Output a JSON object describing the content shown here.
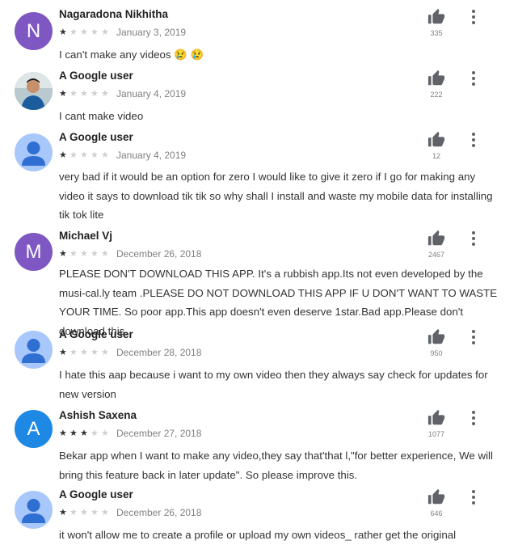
{
  "reviews": [
    {
      "author": "Nagaradona Nikhitha",
      "avatar_letter": "N",
      "avatar_type": "letter",
      "avatar_color": "#7e57c2",
      "rating": 1,
      "date": "January 3, 2019",
      "likes": "335",
      "text": "I can't make any videos 😢 😢"
    },
    {
      "author": "A Google user",
      "avatar_letter": "",
      "avatar_type": "photo",
      "avatar_color": "#c9d4d9",
      "rating": 1,
      "date": "January 4, 2019",
      "likes": "222",
      "text": "I cant make video"
    },
    {
      "author": "A Google user",
      "avatar_letter": "",
      "avatar_type": "person",
      "avatar_color": "#a8c7fa",
      "rating": 1,
      "date": "January 4, 2019",
      "likes": "12",
      "text": "very bad if it would be an option for zero I would like to give it zero if I go for making any video it says to download tik tik so why shall I install and waste my mobile data for installing tik tok lite"
    },
    {
      "author": "Michael Vj",
      "avatar_letter": "M",
      "avatar_type": "letter",
      "avatar_color": "#7e57c2",
      "rating": 1,
      "date": "December 26, 2018",
      "likes": "2467",
      "text": "PLEASE DON'T DOWNLOAD THIS APP. It's a rubbish app.Its not even developed by the musi-cal.ly team .PLEASE DO NOT DOWNLOAD THIS APP IF U DON'T WANT TO WASTE YOUR TIME. So poor app.This app doesn't even deserve 1star.Bad app.Please don't download this."
    },
    {
      "author": "A Google user",
      "avatar_letter": "",
      "avatar_type": "person",
      "avatar_color": "#a8c7fa",
      "rating": 1,
      "date": "December 28, 2018",
      "likes": "950",
      "text": "I hate this aap because i want to my own video then they always say check for updates for new version"
    },
    {
      "author": "Ashish Saxena",
      "avatar_letter": "A",
      "avatar_type": "letter",
      "avatar_color": "#1e88e5",
      "rating": 3,
      "date": "December 27, 2018",
      "likes": "1077",
      "text": "Bekar app when I want to make any video,they say that'that l,\"for better experience, We will bring this feature back in later update\". So please improve this."
    },
    {
      "author": "A Google user",
      "avatar_letter": "",
      "avatar_type": "person",
      "avatar_color": "#a8c7fa",
      "rating": 1,
      "date": "December 26, 2018",
      "likes": "646",
      "text": "it won't allow me to create a profile or upload my own videos_ rather get the original"
    }
  ],
  "colors": {
    "star_on": "#333333",
    "star_off": "#cfcfcf",
    "meta_gray": "#808080"
  }
}
